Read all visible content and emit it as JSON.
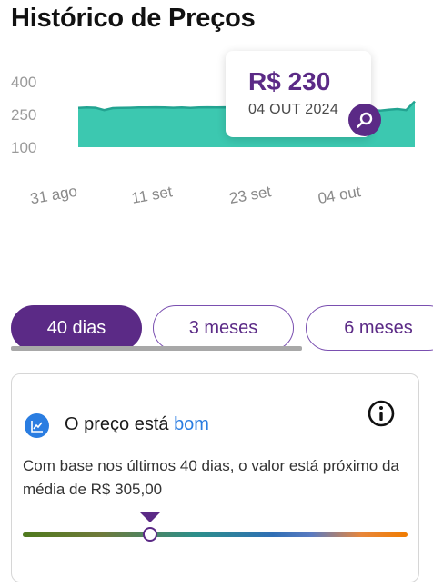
{
  "page": {
    "title": "Histórico de Preços"
  },
  "chart_data": {
    "type": "area",
    "y_ticks": [
      "400",
      "250",
      "100"
    ],
    "x_ticks": [
      "31 ago",
      "11 set",
      "23 set",
      "04 out"
    ],
    "series_values": [
      280,
      282,
      281,
      270,
      279,
      280,
      281,
      282,
      282,
      283,
      282,
      281,
      282,
      280,
      282,
      283,
      282,
      283,
      281,
      283,
      282,
      283,
      282,
      281,
      283,
      282,
      282,
      283,
      282,
      283,
      282,
      283,
      230,
      245,
      270,
      268,
      272,
      275,
      270,
      310
    ],
    "y_range": [
      100,
      400
    ],
    "fill_color": "#3cc8b0",
    "line_color": "#23a391"
  },
  "tooltip": {
    "price": "R$ 230",
    "date": "04 OUT 2024"
  },
  "tabs": [
    {
      "label": "40 dias",
      "active": true
    },
    {
      "label": "3 meses",
      "active": false
    },
    {
      "label": "6 meses",
      "active": false
    }
  ],
  "card": {
    "status_prefix": "O preço está ",
    "status_value": "bom",
    "description": "Com base nos últimos 40 dias, o valor está próximo da média de R$ 305,00",
    "marker_fraction": 0.33
  },
  "colors": {
    "primary": "#5b2a86",
    "accent_blue": "#2a7de1"
  },
  "icons": {
    "chart": "chart-line-icon",
    "info": "info-icon",
    "zoom": "search-icon"
  }
}
